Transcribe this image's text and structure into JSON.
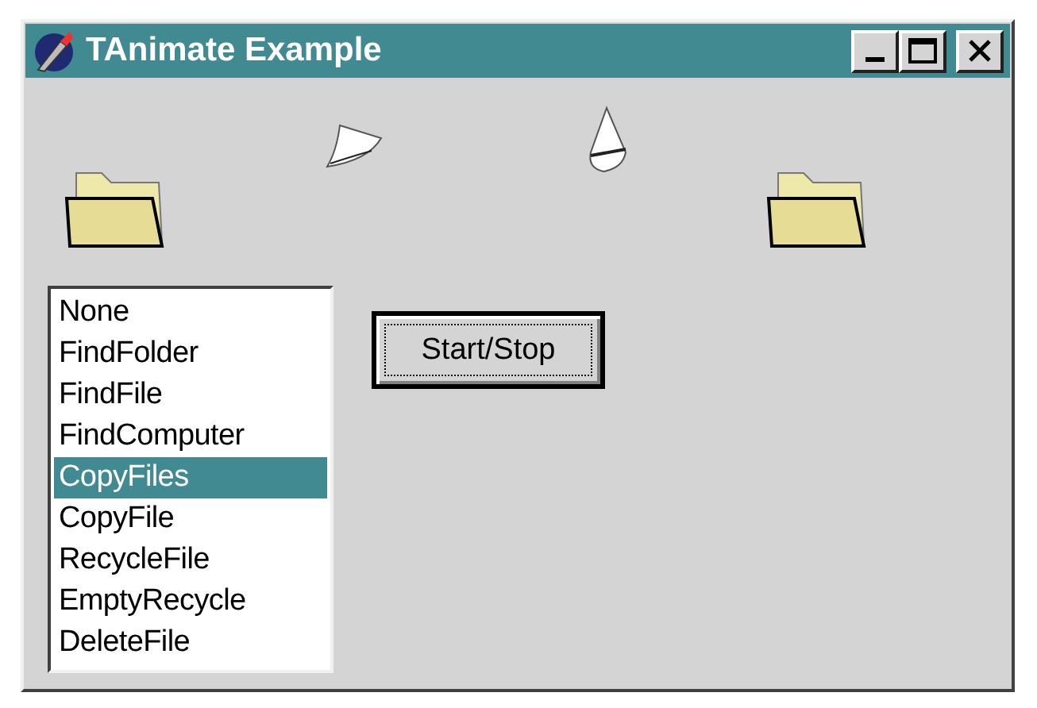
{
  "window": {
    "title": "TAnimate Example"
  },
  "list": {
    "items": [
      {
        "label": "None",
        "selected": false
      },
      {
        "label": "FindFolder",
        "selected": false
      },
      {
        "label": "FindFile",
        "selected": false
      },
      {
        "label": "FindComputer",
        "selected": false
      },
      {
        "label": "CopyFiles",
        "selected": true
      },
      {
        "label": "CopyFile",
        "selected": false
      },
      {
        "label": "RecycleFile",
        "selected": false
      },
      {
        "label": "EmptyRecycle",
        "selected": false
      },
      {
        "label": "DeleteFile",
        "selected": false
      }
    ]
  },
  "button": {
    "label": "Start/Stop"
  }
}
